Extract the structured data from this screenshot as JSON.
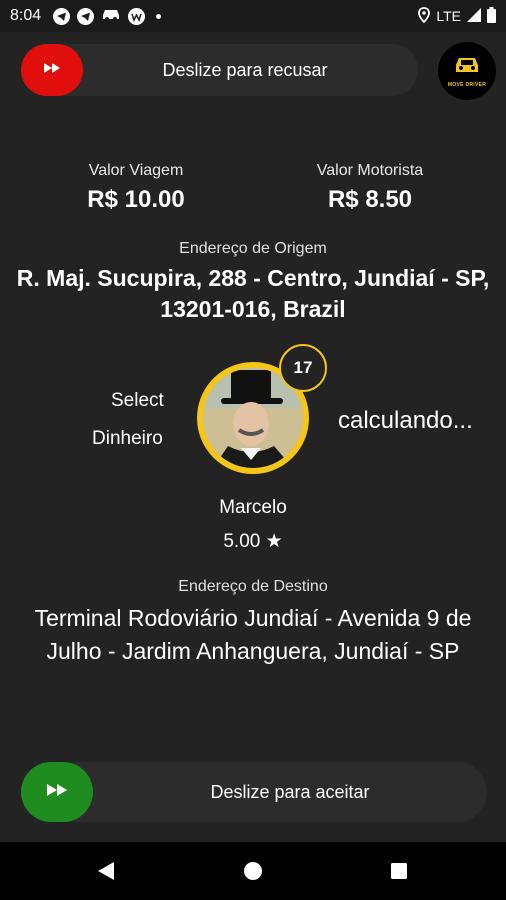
{
  "status_bar": {
    "time": "8:04",
    "network": "LTE",
    "left_icons": [
      "telegram-icon",
      "telegram-icon",
      "car-icon",
      "wp-icon"
    ],
    "right_icons": [
      "location-icon",
      "signal-icon",
      "battery-icon"
    ]
  },
  "reject_slider": {
    "label": "Deslize para recusar",
    "knob_color": "#e10e0e"
  },
  "accept_slider": {
    "label": "Deslize para aceitar",
    "knob_color": "#1f8c1f"
  },
  "logo": {
    "text": "MOVE DRIVER"
  },
  "trip": {
    "valor_viagem_label": "Valor Viagem",
    "valor_viagem": "R$ 10.00",
    "valor_motorista_label": "Valor Motorista",
    "valor_motorista": "R$ 8.50"
  },
  "origin": {
    "label": "Endereço de Origem",
    "address": "R. Maj. Sucupira, 288 - Centro, Jundiaí - SP, 13201-016, Brazil"
  },
  "passenger": {
    "payment_select": "Select",
    "payment_method": "Dinheiro",
    "badge_count": "17",
    "status": "calculando...",
    "name": "Marcelo",
    "rating": "5.00 ★"
  },
  "destination": {
    "label": "Endereço de Destino",
    "address": "Terminal Rodoviário Jundiaí - Avenida 9 de Julho - Jardim Anhanguera, Jundiaí - SP"
  },
  "colors": {
    "accent_yellow": "#f5c518",
    "background": "#232323"
  }
}
